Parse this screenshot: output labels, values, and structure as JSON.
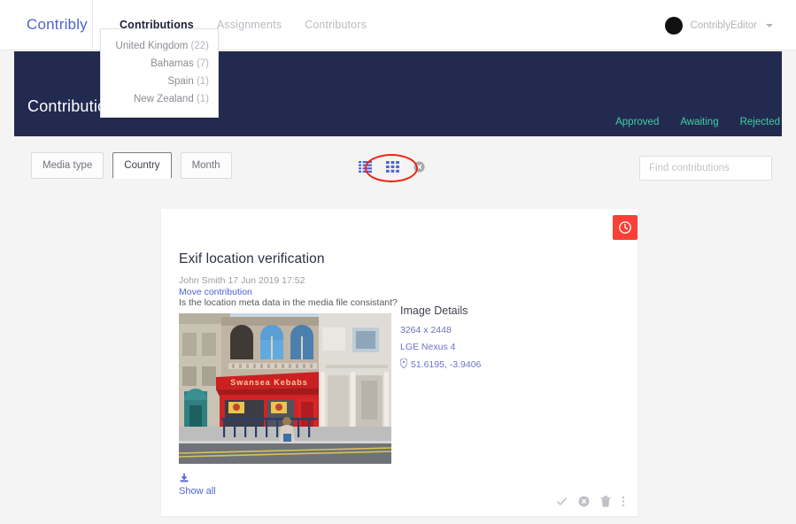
{
  "nav": {
    "brand": "Contribly",
    "links": [
      {
        "label": "Contributions",
        "active": true
      },
      {
        "label": "Assignments",
        "active": false
      },
      {
        "label": "Contributors",
        "active": false
      }
    ],
    "user": {
      "name": "ContriblyEditor",
      "avatar_icon": "avatar-circle-icon",
      "caret_icon": "chevron-down-icon"
    }
  },
  "banner": {
    "title": "Contributions (73)",
    "links": [
      "Approved",
      "Awaiting",
      "Rejected"
    ],
    "background_color": "#232a50",
    "link_color": "#3ecfa0"
  },
  "toolbar": {
    "filters": [
      {
        "label": "Media type",
        "open": false
      },
      {
        "label": "Country",
        "open": true
      },
      {
        "label": "Month",
        "open": false
      }
    ],
    "dropdown": {
      "items": [
        {
          "label": "United Kingdom",
          "count": "(22)"
        },
        {
          "label": "Bahamas",
          "count": "(7)"
        },
        {
          "label": "Spain",
          "count": "(1)"
        },
        {
          "label": "New Zealand",
          "count": "(1)"
        }
      ]
    },
    "view_icons": [
      {
        "name": "list-view-icon"
      },
      {
        "name": "grid-view-icon",
        "selected": true
      },
      {
        "name": "clear-filter-icon"
      }
    ],
    "download_icon": "download-icon",
    "highlight_color": "#f0230e",
    "search": {
      "placeholder": "Find contributions",
      "value": ""
    }
  },
  "card": {
    "status_icon": "clock-icon",
    "status_color": "#f93f36",
    "title": "Exif location verification",
    "meta": "John Smith 17 Jun 2019 17:52",
    "move_link": "Move contribution",
    "question": "Is the location meta data in the media file consistant?",
    "photo": {
      "alt": "Swansea Kebabs storefront",
      "sign_text": "Swansea Kebabs"
    },
    "details": {
      "title": "Image Details",
      "dimensions": "3264 x 2448",
      "device": "LGE Nexus 4",
      "location_icon": "map-pin-icon",
      "coordinates": "51.6195, -3.9406"
    },
    "download_icon": "download-icon",
    "show_all": "Show all",
    "actions": [
      {
        "name": "approve-icon"
      },
      {
        "name": "reject-icon"
      },
      {
        "name": "delete-icon"
      },
      {
        "name": "more-options-icon"
      }
    ]
  }
}
